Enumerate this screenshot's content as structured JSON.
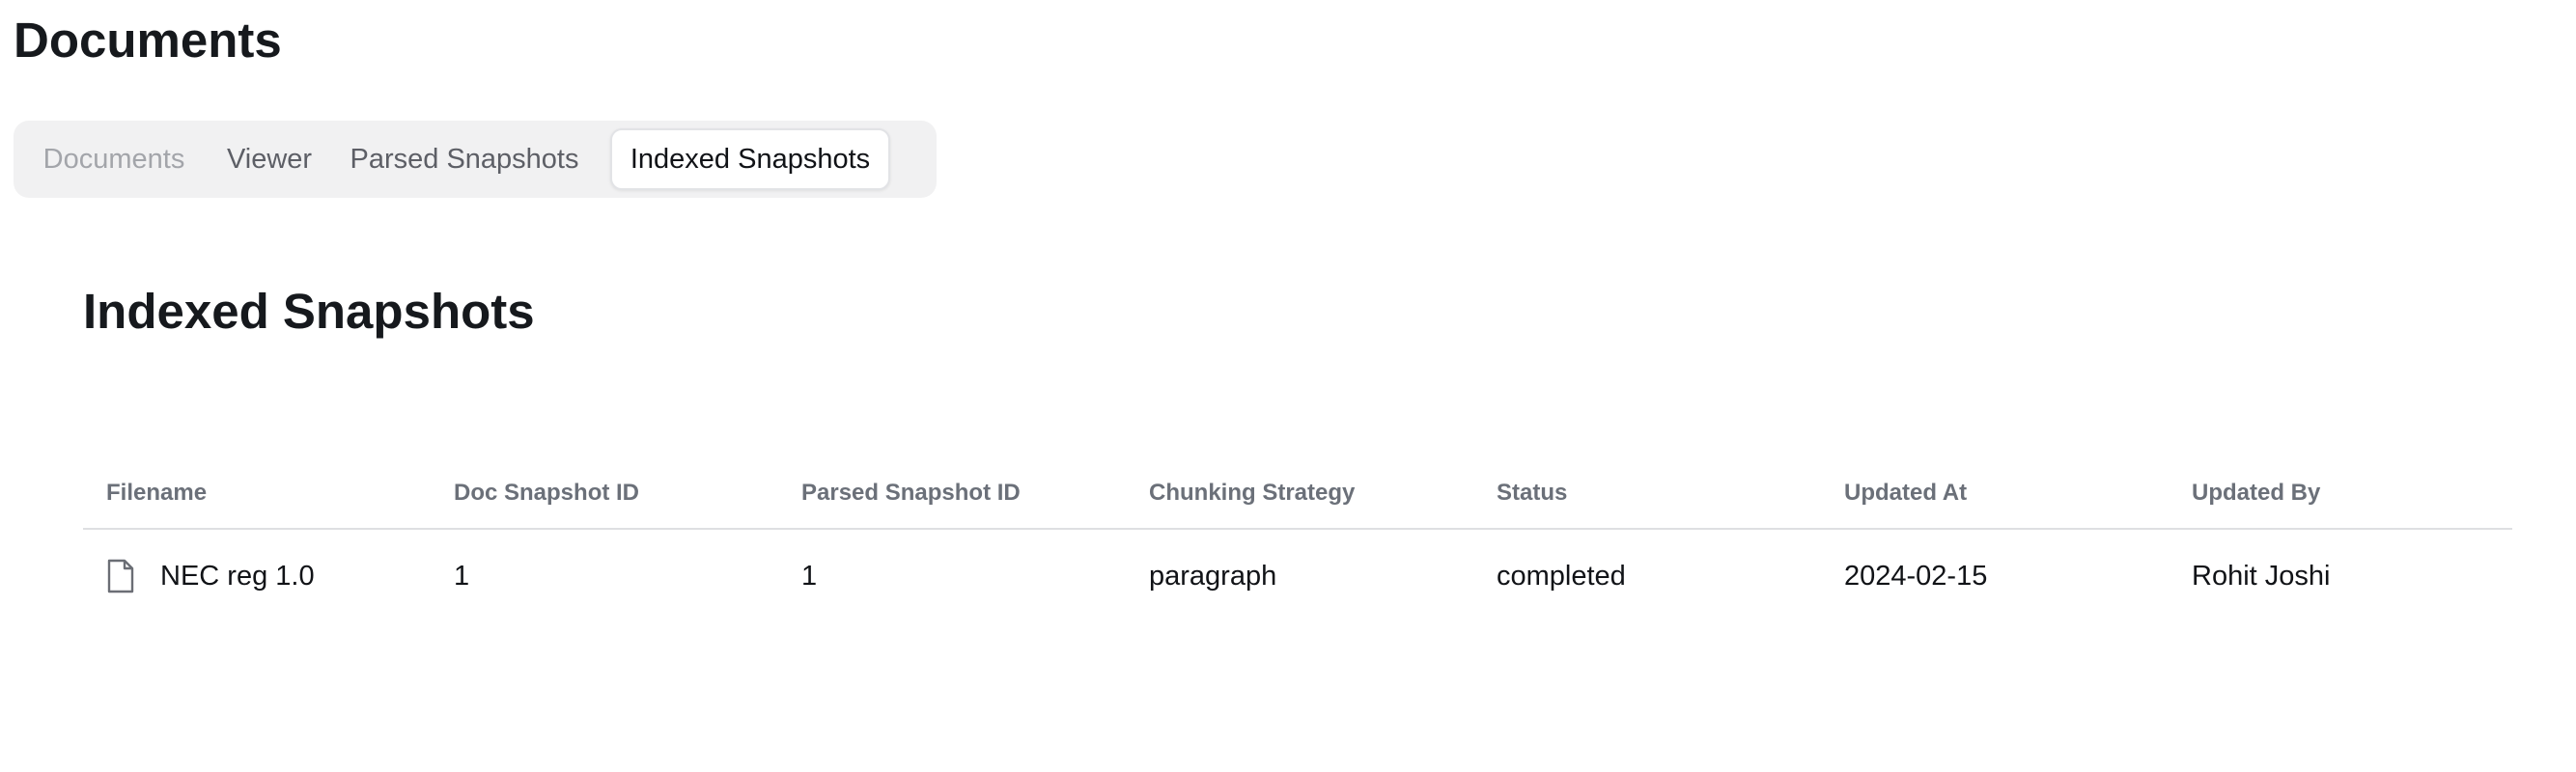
{
  "header": {
    "title": "Documents"
  },
  "tabs": [
    {
      "label": "Documents",
      "state": "disabled"
    },
    {
      "label": "Viewer",
      "state": "inactive"
    },
    {
      "label": "Parsed Snapshots",
      "state": "inactive"
    },
    {
      "label": "Indexed Snapshots",
      "state": "active"
    }
  ],
  "section": {
    "title": "Indexed Snapshots"
  },
  "table": {
    "columns": [
      "Filename",
      "Doc Snapshot ID",
      "Parsed Snapshot ID",
      "Chunking Strategy",
      "Status",
      "Updated At",
      "Updated By"
    ],
    "rows": [
      {
        "filename": "NEC reg 1.0",
        "file_icon": "file-icon",
        "doc_snapshot_id": "1",
        "parsed_snapshot_id": "1",
        "chunking_strategy": "paragraph",
        "status": "completed",
        "updated_at": "2024-02-15",
        "updated_by": "Rohit Joshi"
      }
    ]
  }
}
